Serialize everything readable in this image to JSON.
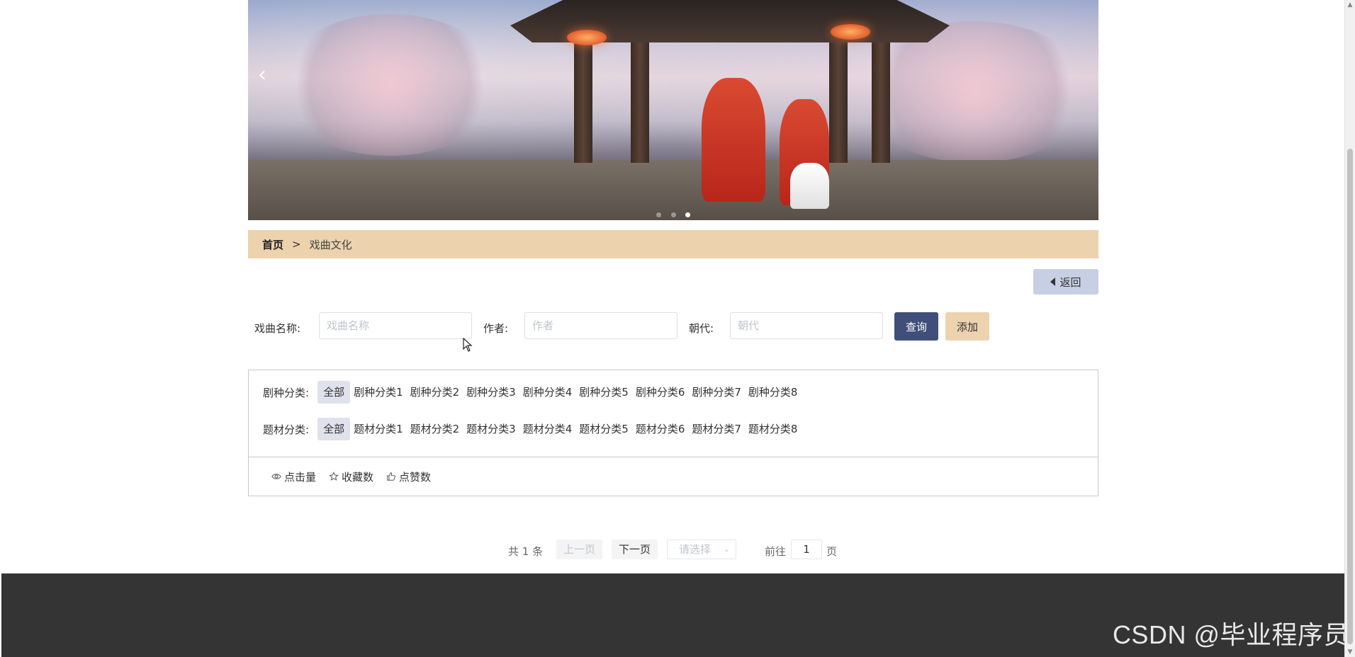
{
  "banner": {
    "prev_arrow": "‹",
    "slide_count": 3,
    "active_slide": 3
  },
  "breadcrumb": {
    "home": "首页",
    "separator": ">",
    "current": "戏曲文化"
  },
  "back_button": {
    "label": "返回"
  },
  "search": {
    "name_label": "戏曲名称:",
    "name_placeholder": "戏曲名称",
    "author_label": "作者:",
    "author_placeholder": "作者",
    "dynasty_label": "朝代:",
    "dynasty_placeholder": "朝代",
    "query_button": "查询",
    "add_button": "添加"
  },
  "filters": {
    "genre": {
      "title": "剧种分类:",
      "all": "全部",
      "options": [
        "剧种分类1",
        "剧种分类2",
        "剧种分类3",
        "剧种分类4",
        "剧种分类5",
        "剧种分类6",
        "剧种分类7",
        "剧种分类8"
      ]
    },
    "theme": {
      "title": "题材分类:",
      "all": "全部",
      "options": [
        "题材分类1",
        "题材分类2",
        "题材分类3",
        "题材分类4",
        "题材分类5",
        "题材分类6",
        "题材分类7",
        "题材分类8"
      ]
    }
  },
  "sort": {
    "clicks": "点击量",
    "favorites": "收藏数",
    "likes": "点赞数"
  },
  "pagination": {
    "total": "共 1 条",
    "prev": "上一页",
    "next": "下一页",
    "page_size_placeholder": "请选择",
    "goto_label": "前往",
    "goto_value": "1",
    "page_unit": "页"
  },
  "watermark": "CSDN @毕业程序员"
}
